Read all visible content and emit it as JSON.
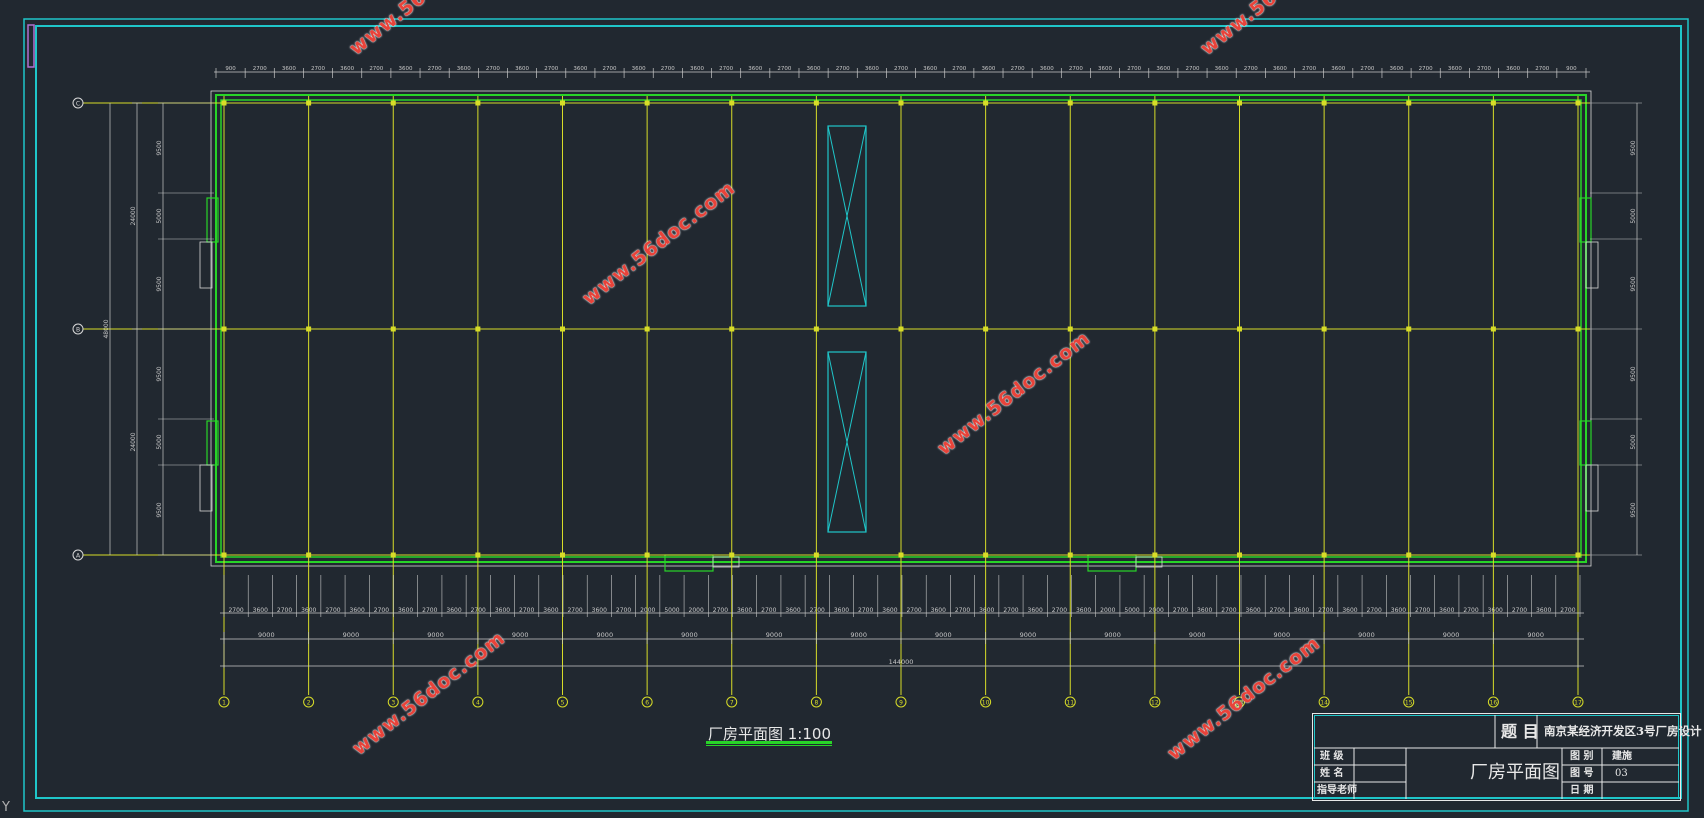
{
  "drawing": {
    "caption": "厂房平面图 1:100",
    "top_dims": [
      "900",
      "2700",
      "3600",
      "2700",
      "3600",
      "2700",
      "3600",
      "2700",
      "3600",
      "2700",
      "3600",
      "2700",
      "3600",
      "2700",
      "3600",
      "2700",
      "3600",
      "2700",
      "3600",
      "2700",
      "3600",
      "2700",
      "3600",
      "2700",
      "3600",
      "2700",
      "3600",
      "2700",
      "3600",
      "2700",
      "3600",
      "2700",
      "3600",
      "2700",
      "3600",
      "2700",
      "3600",
      "2700",
      "3600",
      "2700",
      "3600",
      "2700",
      "3600",
      "2700",
      "3600",
      "2700",
      "900"
    ],
    "bottom_dims_detail": [
      "2700",
      "3600",
      "2700",
      "3600",
      "2700",
      "3600",
      "2700",
      "3600",
      "2700",
      "3600",
      "2700",
      "3600",
      "2700",
      "3600",
      "2700",
      "3600",
      "2700",
      "2000",
      "5000",
      "2000",
      "2700",
      "3600",
      "2700",
      "3600",
      "2700",
      "3600",
      "2700",
      "3600",
      "2700",
      "3600",
      "2700",
      "3600",
      "2700",
      "3600",
      "2700",
      "3600",
      "2000",
      "5000",
      "2000",
      "2700",
      "3600",
      "2700",
      "3600",
      "2700",
      "3600",
      "2700",
      "3600",
      "2700",
      "3600",
      "2700",
      "3600",
      "2700",
      "3600",
      "2700",
      "3600",
      "2700"
    ],
    "bay_dims": [
      "9000",
      "9000",
      "9000",
      "9000",
      "9000",
      "9000",
      "9000",
      "9000",
      "9000",
      "9000",
      "9000",
      "9000",
      "9000",
      "9000",
      "9000",
      "9000"
    ],
    "overall_length": "144000",
    "left_dims_a": [
      "9500",
      "5000",
      "9500",
      "9500",
      "5000",
      "9500"
    ],
    "left_dims_b": [
      "24000",
      "24000"
    ],
    "left_dims_total": "48000",
    "right_dims": [
      "9500",
      "5000",
      "9500",
      "9500",
      "5000",
      "9500"
    ],
    "row_axes": [
      "C",
      "B",
      "A"
    ],
    "col_axes": [
      "1",
      "2",
      "3",
      "4",
      "5",
      "6",
      "7",
      "8",
      "9",
      "10",
      "11",
      "12",
      "13",
      "14",
      "15",
      "16",
      "17"
    ]
  },
  "title_block": {
    "title_label": "题 目",
    "project_title": "南京某经济开发区3号厂房设计",
    "drawing_name": "厂房平面图",
    "rows_left": [
      "班 级",
      "姓 名",
      "指导老师"
    ],
    "right_labels": [
      "图 别",
      "图 号",
      "日 期"
    ],
    "right_values": [
      "建施",
      "03",
      ""
    ]
  },
  "watermark": "www.56doc.com",
  "colors": {
    "background": "#212830",
    "border": "#1fc6c9",
    "wall": "#28d428",
    "grid": "#d7dc28",
    "dim": "#c8c8c8",
    "void": "#1fc6c9",
    "watermark": "#e8433a"
  }
}
